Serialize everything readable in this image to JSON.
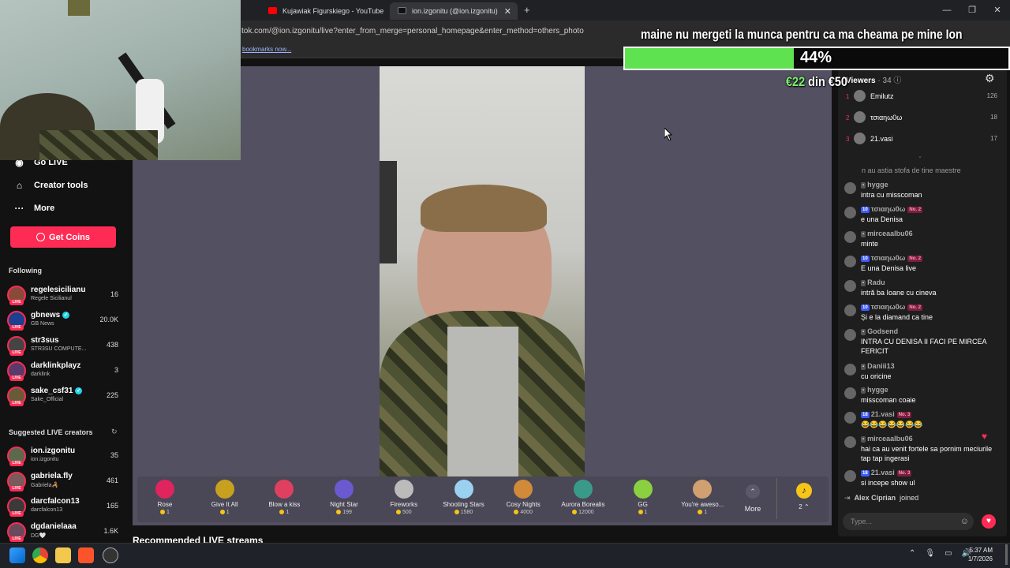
{
  "browser": {
    "tabs": [
      {
        "title": "Kujawiak Figurskiego - YouTube",
        "favicon_color": "#ff0000"
      },
      {
        "title": "ion.izgonitu (@ion.izgonitu) is LIVE",
        "favicon_color": "#000000"
      }
    ],
    "url": "tok.com/@ion.izgonitu/live?enter_from_merge=personal_homepage&enter_method=others_photo",
    "bookmarks_hint": "bookmarks now..."
  },
  "sidebar": {
    "menu": [
      {
        "label": "Go LIVE",
        "icon": "live-icon"
      },
      {
        "label": "Creator tools",
        "icon": "creator-tools-icon"
      },
      {
        "label": "More",
        "icon": "more-icon"
      }
    ],
    "get_coins_label": "Get Coins",
    "following_title": "Following",
    "following": [
      {
        "name": "regelesicilianu",
        "sub": "Regele Sicilianul",
        "count": "16",
        "verified": false,
        "color": "#8a4a3a"
      },
      {
        "name": "gbnews",
        "sub": "GB News",
        "count": "20.0K",
        "verified": true,
        "color": "#1d3f8f"
      },
      {
        "name": "str3sus",
        "sub": "STR3SU COMPUTE...",
        "count": "438",
        "verified": false,
        "color": "#444"
      },
      {
        "name": "darklinkplayz",
        "sub": "darklink",
        "count": "3",
        "verified": false,
        "color": "#5a3a6a"
      },
      {
        "name": "sake_csf31",
        "sub": "Sake_Official",
        "count": "225",
        "verified": true,
        "color": "#6a5a3a"
      }
    ],
    "suggested_title": "Suggested LIVE creators",
    "suggested": [
      {
        "name": "ion.izgonitu",
        "sub": "ion.izgonitu",
        "count": "35",
        "color": "#5a6a4a"
      },
      {
        "name": "gabriela.fly",
        "sub": "Gabriela🦂",
        "count": "461",
        "color": "#7a5a5a"
      },
      {
        "name": "darcfalcon13",
        "sub": "darcfalcon13",
        "count": "165",
        "color": "#3a3a3a"
      },
      {
        "name": "dgdanielaaa",
        "sub": "DG🤍",
        "count": "1.6K",
        "color": "#6a4a5a"
      }
    ]
  },
  "gifts": [
    {
      "name": "Rose",
      "price": "1",
      "color": "#e0245e"
    },
    {
      "name": "Give It All",
      "price": "1",
      "color": "#c8a020"
    },
    {
      "name": "Blow a kiss",
      "price": "1",
      "color": "#e04060"
    },
    {
      "name": "Night Star",
      "price": "199",
      "color": "#6a5ad0"
    },
    {
      "name": "Fireworks",
      "price": "500",
      "color": "#bbbbbb"
    },
    {
      "name": "Shooting Stars",
      "price": "1580",
      "color": "#9ad0f0"
    },
    {
      "name": "Cosy Nights",
      "price": "4000",
      "color": "#d08a3a"
    },
    {
      "name": "Aurora Borealis",
      "price": "12000",
      "color": "#3a9a8a"
    },
    {
      "name": "GG",
      "price": "1",
      "color": "#8ad040"
    },
    {
      "name": "You're aweso...",
      "price": "1",
      "color": "#d0a070"
    }
  ],
  "gift_more_label": "More",
  "coin_count": "2",
  "recommended_title": "Recommended LIVE streams",
  "viewers": {
    "title": "Viewers",
    "count": "34",
    "top": [
      {
        "rank": "1",
        "name": "Emilutz",
        "score": "126"
      },
      {
        "rank": "2",
        "name": "τσιαηω0ω",
        "score": "18"
      },
      {
        "rank": "3",
        "name": "21.vasi",
        "score": "17"
      }
    ]
  },
  "chat": {
    "partial_text": "n au astia stofa de tine maestre",
    "messages": [
      {
        "user": "hygge",
        "level": "",
        "rank": "",
        "text": "intra cu misscoman"
      },
      {
        "user": "τσιαηω0ω",
        "level": "10",
        "rank": "No. 2",
        "text": "e una Denisa"
      },
      {
        "user": "mirceaalbu06",
        "level": "",
        "rank": "",
        "text": "minte"
      },
      {
        "user": "τσιαηω0ω",
        "level": "10",
        "rank": "No. 2",
        "text": "E una Denisa live"
      },
      {
        "user": "Radu",
        "level": "",
        "rank": "",
        "text": "intră ba Ioane cu cineva"
      },
      {
        "user": "τσιαηω0ω",
        "level": "10",
        "rank": "No. 2",
        "text": "Și e la diamand ca tine"
      },
      {
        "user": "Godsend",
        "level": "",
        "rank": "",
        "text": "INTRA CU DENISA II FACI PE MIRCEA FERICIT"
      },
      {
        "user": "Daniii13",
        "level": "",
        "rank": "",
        "text": "cu oricine"
      },
      {
        "user": "hygge",
        "level": "",
        "rank": "",
        "text": "misscoman coaie"
      },
      {
        "user": "21.vasi",
        "level": "18",
        "rank": "No. 3",
        "text": "😂😂😂😂😂😂😂"
      },
      {
        "user": "mirceaalbu06",
        "level": "",
        "rank": "",
        "text": "hai ca au venit fortele sa pornim meciurile tap tap ingerasi"
      },
      {
        "user": "21.vasi",
        "level": "18",
        "rank": "No. 3",
        "text": "si incepe show ul"
      }
    ],
    "joined_user": "Alex Ciprian",
    "joined_text": "joined",
    "input_placeholder": "Type..."
  },
  "overlay": {
    "title": "maine nu mergeti la munca pentru ca ma cheama pe mine Ion",
    "goal_percent": 44,
    "goal_percent_label": "44%",
    "goal_current": "€22",
    "goal_sep": "din",
    "goal_target": "€50",
    "goal_fill_color": "#5ee24f"
  },
  "taskbar": {
    "time": "5:37 AM",
    "date": "1/7/2026"
  },
  "colors": {
    "accent": "#fe2c55",
    "stage": "#535062"
  }
}
